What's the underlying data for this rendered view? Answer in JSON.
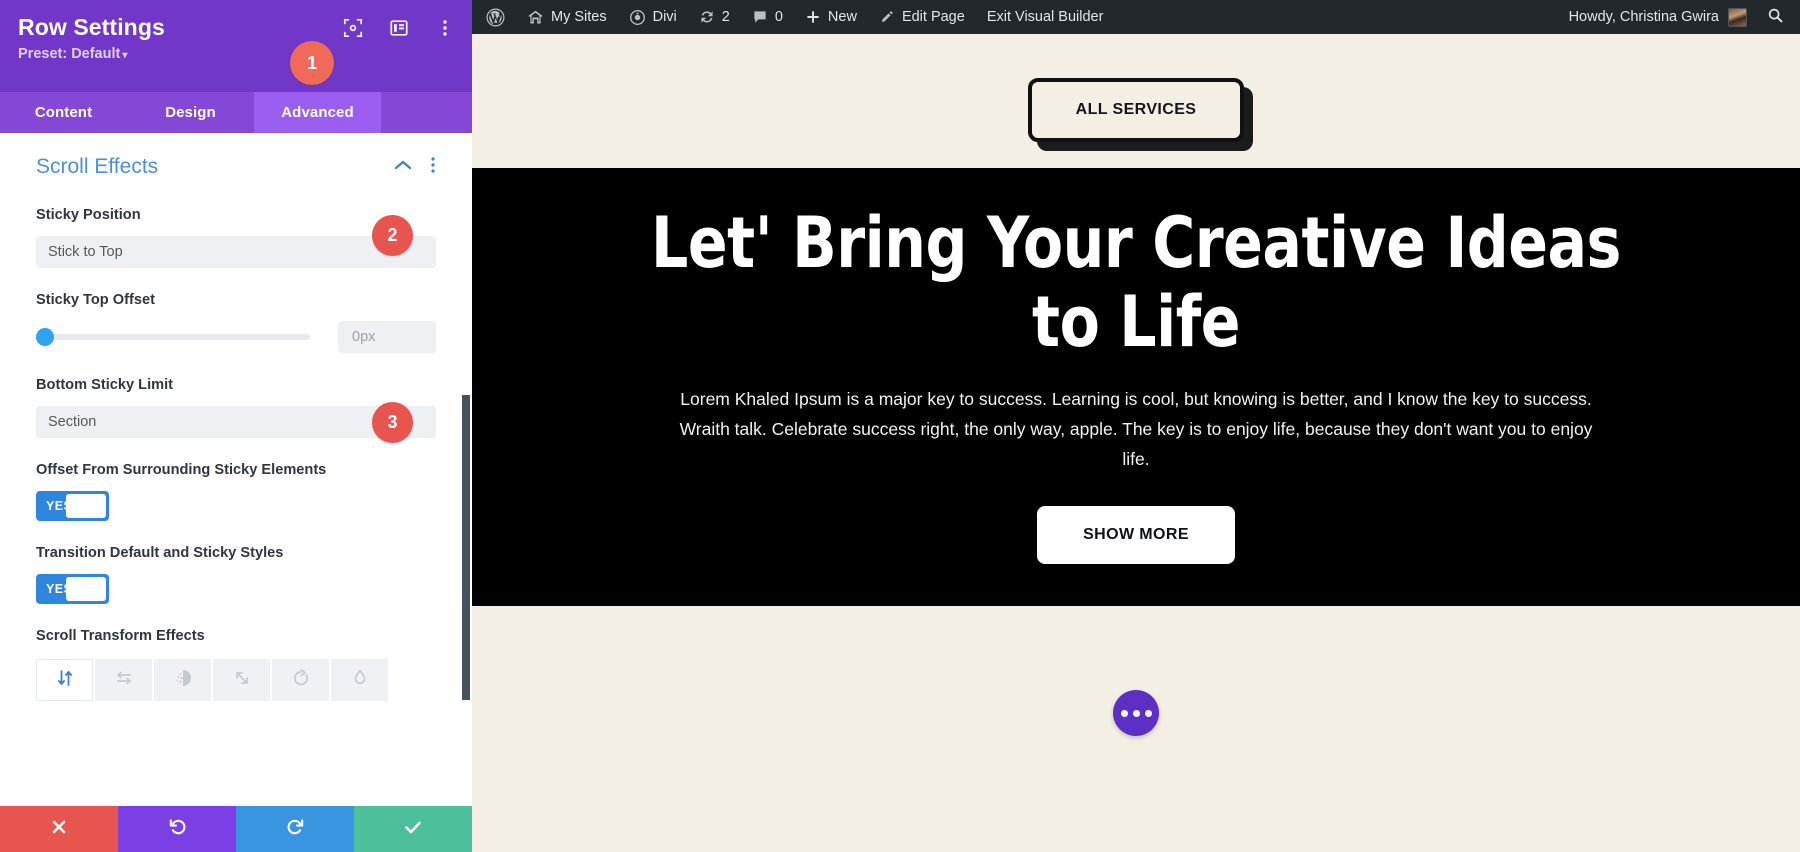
{
  "settings_panel": {
    "title": "Row Settings",
    "preset_label": "Preset: Default",
    "header_icons": [
      "fullscreen-icon",
      "layout-columns-icon",
      "kebab-menu-icon"
    ],
    "tabs": [
      {
        "label": "Content",
        "active": false
      },
      {
        "label": "Design",
        "active": false
      },
      {
        "label": "Advanced",
        "active": true
      }
    ],
    "section": {
      "title": "Scroll Effects",
      "collapse_icon": "chevron-up-icon",
      "menu_icon": "kebab-menu-icon"
    },
    "fields": {
      "sticky_position": {
        "label": "Sticky Position",
        "value": "Stick to Top"
      },
      "sticky_top_offset": {
        "label": "Sticky Top Offset",
        "value": "0px",
        "slider_percent": 0
      },
      "bottom_sticky_limit": {
        "label": "Bottom Sticky Limit",
        "value": "Section"
      },
      "offset_from_surrounding": {
        "label": "Offset From Surrounding Sticky Elements",
        "toggle_value": "YES"
      },
      "transition_styles": {
        "label": "Transition Default and Sticky Styles",
        "toggle_value": "YES"
      },
      "scroll_transform_effects": {
        "label": "Scroll Transform Effects",
        "options": [
          {
            "name": "vertical-motion-icon",
            "active": true
          },
          {
            "name": "horizontal-motion-icon",
            "active": false
          },
          {
            "name": "fade-in-out-icon",
            "active": false
          },
          {
            "name": "scaling-up-down-icon",
            "active": false
          },
          {
            "name": "rotating-icon",
            "active": false
          },
          {
            "name": "blur-icon",
            "active": false
          }
        ]
      }
    },
    "footer": [
      {
        "name": "cancel-button",
        "icon": "close-x-icon"
      },
      {
        "name": "undo-button",
        "icon": "undo-arrow-icon"
      },
      {
        "name": "redo-button",
        "icon": "redo-arrow-icon"
      },
      {
        "name": "save-button",
        "icon": "checkmark-icon"
      }
    ],
    "callouts": [
      {
        "number": "1"
      },
      {
        "number": "2"
      },
      {
        "number": "3"
      }
    ]
  },
  "admin_bar": {
    "items": [
      {
        "label": "",
        "icon": "wordpress-logo-icon"
      },
      {
        "label": "My Sites",
        "icon": "house-multisite-icon"
      },
      {
        "label": "Divi",
        "icon": "divi-gauge-icon"
      },
      {
        "label": "2",
        "icon": "updates-refresh-icon"
      },
      {
        "label": "0",
        "icon": "comment-bubble-icon"
      },
      {
        "label": "New",
        "icon": "plus-icon"
      },
      {
        "label": "Edit Page",
        "icon": "pencil-icon"
      },
      {
        "label": "Exit Visual Builder",
        "icon": ""
      }
    ],
    "howdy": "Howdy, Christina Gwira",
    "avatar": "user-avatar",
    "search_icon": "search-icon"
  },
  "page": {
    "services_button": "ALL SERVICES",
    "hero_heading": "Let' Bring Your Creative Ideas to Life",
    "hero_paragraph": "Lorem Khaled Ipsum is a major key to success. Learning is cool, but knowing is better, and I know the key to success. Wraith talk. Celebrate success right, the only way, apple. The key is to enjoy life, because they don't want you to enjoy life.",
    "show_more_button": "SHOW MORE",
    "fab_icon": "ellipsis-icon"
  },
  "colors": {
    "panel_header": "#7137c8",
    "tab_active": "#9b5ef0",
    "section_title": "#4a8fde",
    "toggle_on": "#2e86de",
    "badge": "#e8554e",
    "canvas_bg": "#f3efe4",
    "hero_bg": "#000000",
    "admin_bar": "#23282d",
    "fab": "#5d2fc4"
  }
}
